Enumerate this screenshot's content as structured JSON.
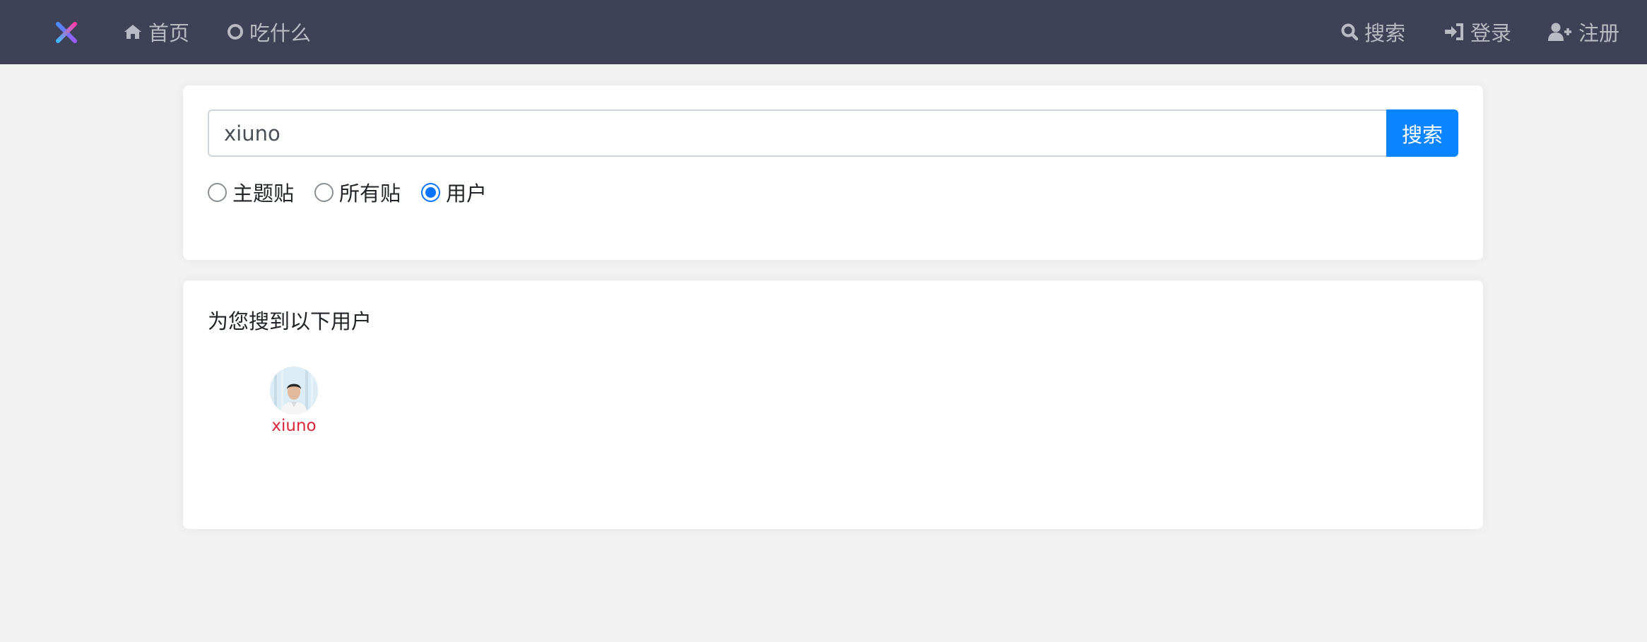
{
  "navbar": {
    "home_label": "首页",
    "eat_label": "吃什么",
    "search_label": "搜索",
    "login_label": "登录",
    "register_label": "注册"
  },
  "search": {
    "query": "xiuno",
    "button_label": "搜索",
    "options": [
      {
        "label": "主题贴",
        "checked": false
      },
      {
        "label": "所有贴",
        "checked": false
      },
      {
        "label": "用户",
        "checked": true
      }
    ]
  },
  "results": {
    "title": "为您搜到以下用户",
    "users": [
      {
        "name": "xiuno"
      }
    ]
  },
  "colors": {
    "navbar_bg": "#3f4156",
    "accent": "#0a84ff",
    "username": "#d9263a"
  }
}
